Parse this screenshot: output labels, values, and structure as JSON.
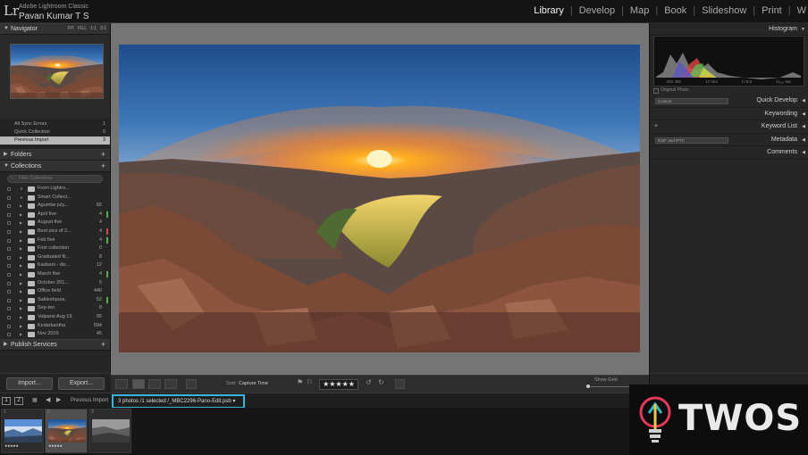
{
  "app": {
    "logo": "Lr",
    "brand_line1": "Adobe Lightroom Classic",
    "brand_line2": "Pavan Kumar T S"
  },
  "modules": [
    "Library",
    "Develop",
    "Map",
    "Book",
    "Slideshow",
    "Print",
    "W"
  ],
  "active_module": "Library",
  "left_panel": {
    "navigator_title": "Navigator",
    "navigator_tabs": [
      "FIT",
      "FILL",
      "1:1",
      "3:1"
    ],
    "catalog_items": [
      {
        "label": "All Sync Errors",
        "count": "1"
      },
      {
        "label": "Quick Collection",
        "count": "0"
      },
      {
        "label": "Previous Import",
        "count": "3"
      }
    ],
    "folders_title": "Folders",
    "collections_title": "Collections",
    "filter_placeholder": "Filter Collections",
    "collections": [
      {
        "label": "From Lightro...",
        "count": ""
      },
      {
        "label": "Smart Collect...",
        "count": ""
      },
      {
        "label": "Agumbe july...",
        "count": "65",
        "flag": ""
      },
      {
        "label": "April five",
        "count": "4",
        "flag": "#4fb04f"
      },
      {
        "label": "August five",
        "count": "4",
        "flag": ""
      },
      {
        "label": "Best pics of 2...",
        "count": "4",
        "flag": "#c84a4a"
      },
      {
        "label": "Feb five",
        "count": "4",
        "flag": "#4fb04f"
      },
      {
        "label": "First collection",
        "count": "0",
        "flag": ""
      },
      {
        "label": "Graduated fil...",
        "count": "8",
        "flag": ""
      },
      {
        "label": "Kadsani - dis...",
        "count": "12",
        "flag": ""
      },
      {
        "label": "March five",
        "count": "4",
        "flag": "#4fb04f"
      },
      {
        "label": "October 201...",
        "count": "5",
        "flag": ""
      },
      {
        "label": "Office field",
        "count": "440",
        "flag": ""
      },
      {
        "label": "Sakleshpura",
        "count": "52",
        "flag": "#4fb04f"
      },
      {
        "label": "Sep-ten",
        "count": "8",
        "flag": ""
      },
      {
        "label": "Valparai Aug 19",
        "count": "95",
        "flag": ""
      },
      {
        "label": "Kedarkantha",
        "count": "594",
        "flag": ""
      },
      {
        "label": "Nov 2019",
        "count": "45",
        "flag": ""
      }
    ],
    "publish_title": "Publish Services",
    "import_label": "Import...",
    "export_label": "Export..."
  },
  "toolbar": {
    "sort_label": "Sort:",
    "sort_value": "Capture Time",
    "rating": "★★★★★",
    "show_grid": "Show Grid"
  },
  "right_panel": {
    "histogram_title": "Histogram",
    "histogram_info": [
      "ISO 400",
      "17 mm",
      "f / 8.0",
      "1/₁₆₀ sec"
    ],
    "original_photo": "Original Photo",
    "sections": [
      {
        "label": "Quick Develop",
        "dropdown": "Custom"
      },
      {
        "label": "Keywording",
        "dropdown": ""
      },
      {
        "label": "Keyword List",
        "dropdown": ""
      },
      {
        "label": "Metadata",
        "dropdown": "EXIF and IPTC"
      },
      {
        "label": "Comments",
        "dropdown": ""
      }
    ]
  },
  "filmstrip_bar": {
    "page1": "1",
    "page2": "2",
    "source": "Previous Import",
    "path": "3 photos /1 selected /_MBC2296-Pano-Edit.psb ▾"
  },
  "filmstrip": [
    {
      "num": "1",
      "stars": "★★★★★",
      "selected": false
    },
    {
      "num": "2",
      "stars": "★★★★★",
      "selected": true
    },
    {
      "num": "3",
      "stars": "",
      "selected": false
    }
  ],
  "watermark": "TWOS"
}
